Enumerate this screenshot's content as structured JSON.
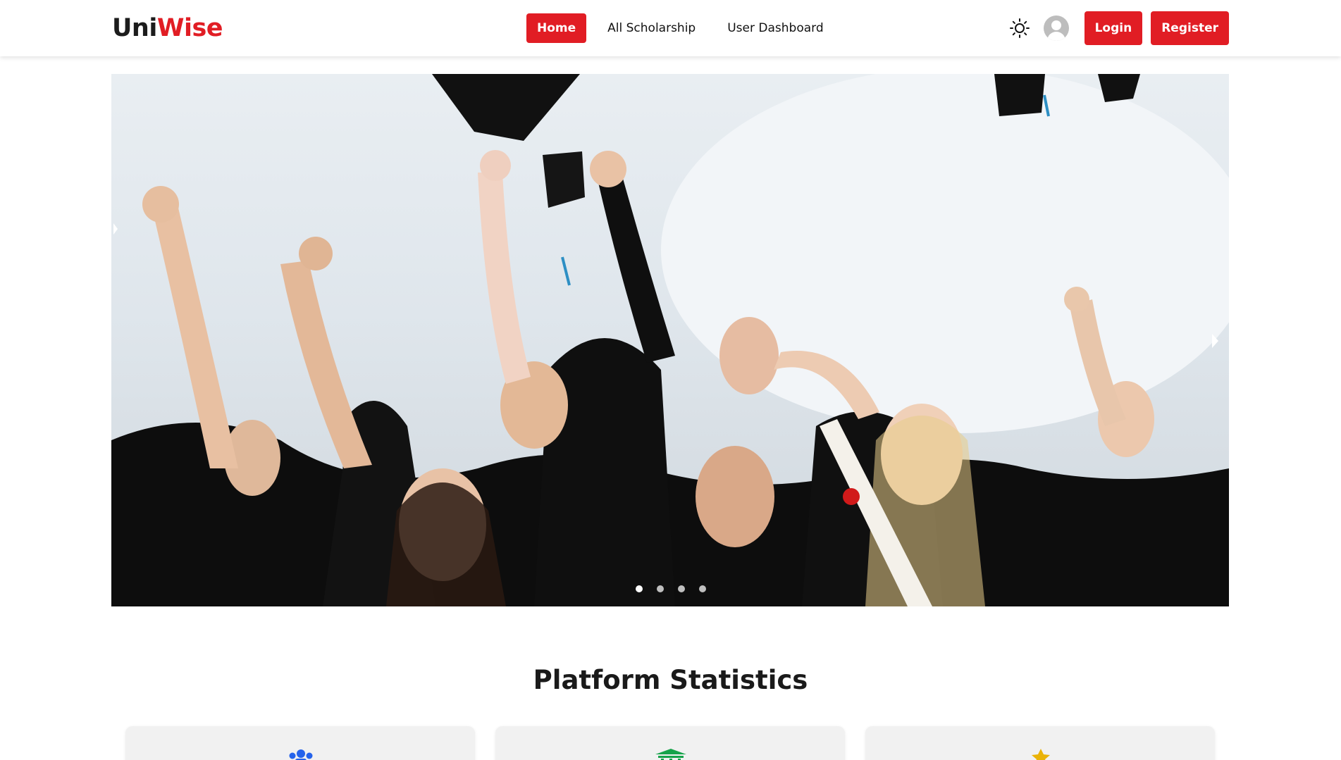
{
  "brand": {
    "part1": "Uni",
    "part2": "Wise",
    "accent_color": "#e11d24"
  },
  "nav": {
    "items": [
      {
        "label": "Home",
        "active": true
      },
      {
        "label": "All Scholarship",
        "active": false
      },
      {
        "label": "User Dashboard",
        "active": false
      }
    ]
  },
  "header_actions": {
    "theme_icon": "sun-icon",
    "avatar_icon": "user-avatar-icon",
    "login_label": "Login",
    "register_label": "Register"
  },
  "hero": {
    "image_description_icon": "graduation-photo",
    "slide_count": 4,
    "active_slide": 1
  },
  "stats": {
    "title": "Platform Statistics",
    "cards": [
      {
        "icon": "users-icon",
        "color": "#2563eb"
      },
      {
        "icon": "university-icon",
        "color": "#16a34a"
      },
      {
        "icon": "star-icon",
        "color": "#eab308"
      }
    ]
  }
}
